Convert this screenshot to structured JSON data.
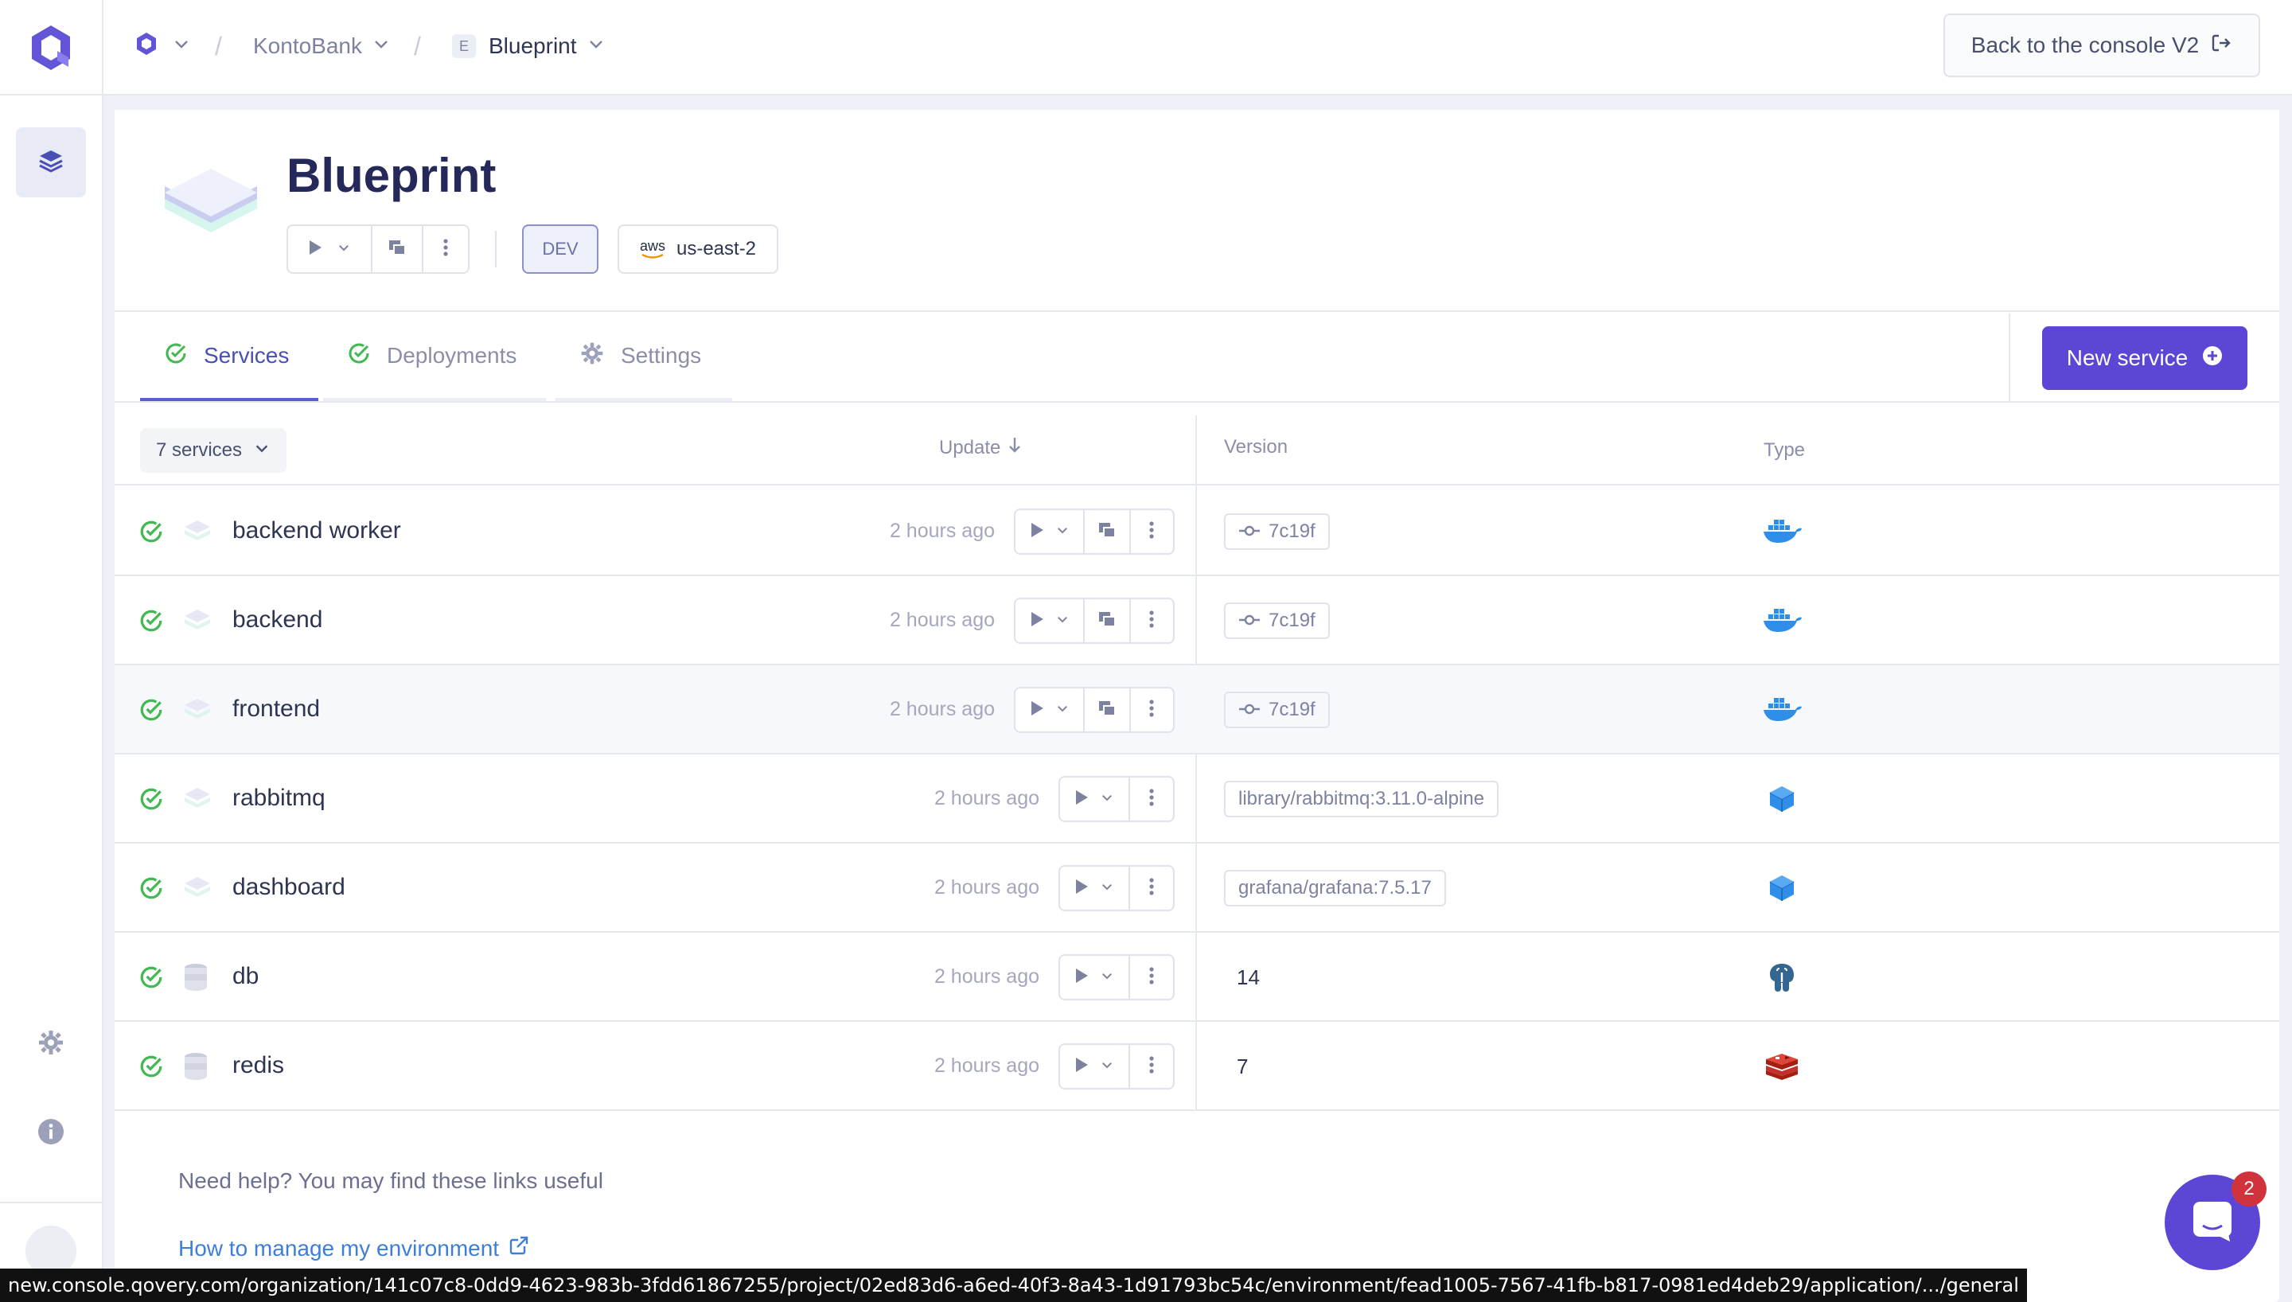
{
  "breadcrumb": {
    "organization": "KontoBank",
    "environment_letter": "E",
    "environment": "Blueprint"
  },
  "top_right": {
    "back_label": "Back to the console V2"
  },
  "header": {
    "title": "Blueprint",
    "mode_badge": "DEV",
    "cloud_provider_label": "aws",
    "region": "us-east-2"
  },
  "tabs": [
    {
      "label": "Services",
      "active": true
    },
    {
      "label": "Deployments",
      "active": false
    },
    {
      "label": "Settings",
      "active": false
    }
  ],
  "new_service_label": "New service",
  "table": {
    "count_label": "7 services",
    "headers": {
      "update": "Update",
      "version": "Version",
      "type": "Type"
    },
    "rows": [
      {
        "name": "backend worker",
        "time": "2 hours ago",
        "version": "7c19f",
        "version_kind": "commit",
        "type": "docker"
      },
      {
        "name": "backend",
        "time": "2 hours ago",
        "version": "7c19f",
        "version_kind": "commit",
        "type": "docker"
      },
      {
        "name": "frontend",
        "time": "2 hours ago",
        "version": "7c19f",
        "version_kind": "commit",
        "type": "docker"
      },
      {
        "name": "rabbitmq",
        "time": "2 hours ago",
        "version": "library/rabbitmq:3.11.0-alpine",
        "version_kind": "image",
        "type": "container"
      },
      {
        "name": "dashboard",
        "time": "2 hours ago",
        "version": "grafana/grafana:7.5.17",
        "version_kind": "image",
        "type": "container"
      },
      {
        "name": "db",
        "time": "2 hours ago",
        "version": "14",
        "version_kind": "plain",
        "type": "postgresql"
      },
      {
        "name": "redis",
        "time": "2 hours ago",
        "version": "7",
        "version_kind": "plain",
        "type": "redis"
      }
    ]
  },
  "help": {
    "text": "Need help? You may find these links useful",
    "link": "How to manage my environment"
  },
  "chat_badge": "2",
  "status_url": "new.console.qovery.com/organization/141c07c8-0dd9-4623-983b-3fdd61867255/project/02ed83d6-a6ed-40f3-8a43-1d91793bc54c/environment/fead1005-7567-41fb-b817-0981ed4deb29/application/.../general",
  "colors": {
    "accent": "#5b46d6",
    "success": "#3fb950",
    "link": "#3d7fd8"
  }
}
